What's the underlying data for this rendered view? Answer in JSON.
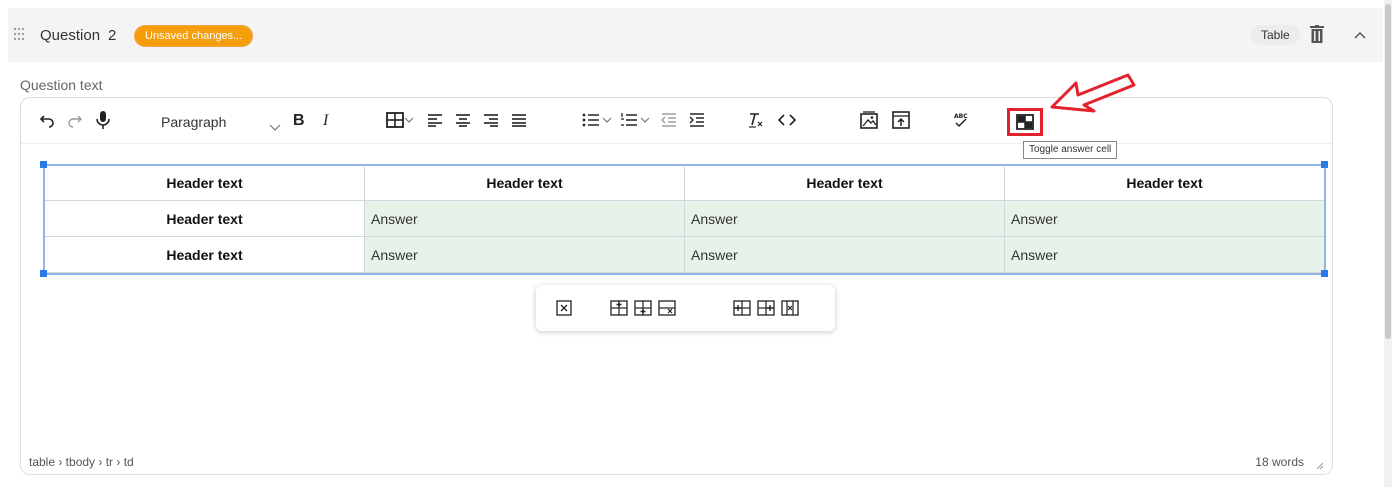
{
  "question": {
    "title": "Question",
    "number": "2",
    "badge": "Unsaved changes...",
    "type": "Table"
  },
  "editor": {
    "label": "Question text",
    "block_format": "Paragraph",
    "bold": "B",
    "italic": "I",
    "tooltip": "Toggle answer cell",
    "status_path": "table › tbody › tr › td",
    "word_count": "18 words"
  },
  "table": {
    "header_row": [
      "Header text",
      "Header text",
      "Header text",
      "Header text"
    ],
    "rows": [
      [
        "Header text",
        "Answer",
        "Answer",
        "Answer"
      ],
      [
        "Header text",
        "Answer",
        "Answer",
        "Answer"
      ]
    ]
  },
  "icons": {
    "toolbar": [
      "undo-icon",
      "redo-icon",
      "microphone-icon",
      "table-icon",
      "align-left-icon",
      "align-center-icon",
      "align-right-icon",
      "justify-icon",
      "bullet-list-icon",
      "numbered-list-icon",
      "outdent-icon",
      "indent-icon",
      "clear-formatting-icon",
      "code-icon",
      "insert-image-icon",
      "upload-icon",
      "spellcheck-icon",
      "toggle-answer-cell-icon"
    ],
    "table_toolbar": [
      "delete-table-icon",
      "insert-row-before-icon",
      "insert-row-after-icon",
      "delete-row-icon",
      "insert-column-before-icon",
      "insert-column-after-icon",
      "delete-column-icon"
    ]
  },
  "colors": {
    "badge": "#f59e0b",
    "answer_cell": "#e7f3e8",
    "annotation_red": "#e4222b",
    "selection_blue": "#2a79e8"
  }
}
